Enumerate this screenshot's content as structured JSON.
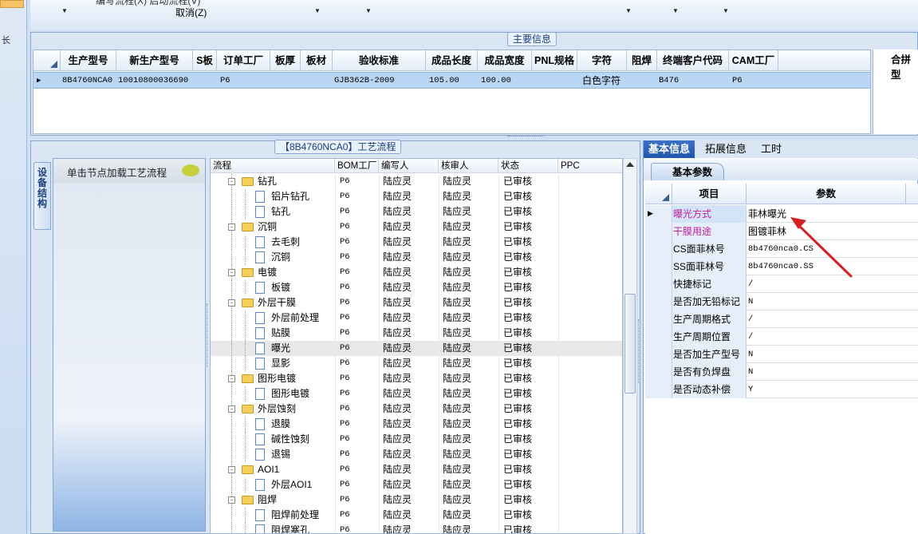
{
  "toolbar": {
    "cut_text": "编写流程(X)  启动流程(V)",
    "cancel_label": "取消(Z)",
    "left_mark": "长"
  },
  "main": {
    "legend": "主要信息",
    "columns": [
      "生产型号",
      "新生产型号",
      "S板",
      "订单工厂",
      "板厚",
      "板材",
      "验收标准",
      "成品长度",
      "成品宽度",
      "PNL规格",
      "字符",
      "阻焊",
      "终端客户代码",
      "CAM工厂"
    ],
    "row": [
      "8B4760NCA0",
      "10010800036690",
      "",
      "P6",
      "",
      "",
      "GJB362B-2009",
      "105.00",
      "100.00",
      "",
      "白色字符",
      "",
      "B476",
      "P6"
    ],
    "merge_title": "合拼型"
  },
  "process": {
    "legend": "【8B4760NCA0】工艺流程",
    "vtab": "设备结构",
    "node_hint": "单击节点加载工艺流程",
    "columns": [
      "流程",
      "BOM工厂",
      "编写人",
      "核审人",
      "状态",
      "PPC"
    ],
    "rows": [
      {
        "name": "钻孔",
        "type": "folder",
        "bom": "P6",
        "writer": "陆应灵",
        "reviewer": "陆应灵",
        "status": "已审核"
      },
      {
        "name": "铝片钻孔",
        "type": "file",
        "bom": "P6",
        "writer": "陆应灵",
        "reviewer": "陆应灵",
        "status": "已审核"
      },
      {
        "name": "钻孔",
        "type": "file",
        "bom": "P6",
        "writer": "陆应灵",
        "reviewer": "陆应灵",
        "status": "已审核"
      },
      {
        "name": "沉铜",
        "type": "folder",
        "bom": "P6",
        "writer": "陆应灵",
        "reviewer": "陆应灵",
        "status": "已审核"
      },
      {
        "name": "去毛刺",
        "type": "file",
        "bom": "P6",
        "writer": "陆应灵",
        "reviewer": "陆应灵",
        "status": "已审核"
      },
      {
        "name": "沉铜",
        "type": "file",
        "bom": "P6",
        "writer": "陆应灵",
        "reviewer": "陆应灵",
        "status": "已审核"
      },
      {
        "name": "电镀",
        "type": "folder",
        "bom": "P6",
        "writer": "陆应灵",
        "reviewer": "陆应灵",
        "status": "已审核"
      },
      {
        "name": "板镀",
        "type": "file",
        "bom": "P6",
        "writer": "陆应灵",
        "reviewer": "陆应灵",
        "status": "已审核"
      },
      {
        "name": "外层干膜",
        "type": "folder",
        "bom": "P6",
        "writer": "陆应灵",
        "reviewer": "陆应灵",
        "status": "已审核"
      },
      {
        "name": "外层前处理",
        "type": "file",
        "bom": "P6",
        "writer": "陆应灵",
        "reviewer": "陆应灵",
        "status": "已审核"
      },
      {
        "name": "贴膜",
        "type": "file",
        "bom": "P6",
        "writer": "陆应灵",
        "reviewer": "陆应灵",
        "status": "已审核"
      },
      {
        "name": "曝光",
        "type": "file",
        "bom": "P6",
        "writer": "陆应灵",
        "reviewer": "陆应灵",
        "status": "已审核",
        "selected": true
      },
      {
        "name": "显影",
        "type": "file",
        "bom": "P6",
        "writer": "陆应灵",
        "reviewer": "陆应灵",
        "status": "已审核"
      },
      {
        "name": "图形电镀",
        "type": "folder",
        "bom": "P6",
        "writer": "陆应灵",
        "reviewer": "陆应灵",
        "status": "已审核"
      },
      {
        "name": "图形电镀",
        "type": "file",
        "bom": "P6",
        "writer": "陆应灵",
        "reviewer": "陆应灵",
        "status": "已审核"
      },
      {
        "name": "外层蚀刻",
        "type": "folder",
        "bom": "P6",
        "writer": "陆应灵",
        "reviewer": "陆应灵",
        "status": "已审核"
      },
      {
        "name": "退膜",
        "type": "file",
        "bom": "P6",
        "writer": "陆应灵",
        "reviewer": "陆应灵",
        "status": "已审核"
      },
      {
        "name": "碱性蚀刻",
        "type": "file",
        "bom": "P6",
        "writer": "陆应灵",
        "reviewer": "陆应灵",
        "status": "已审核"
      },
      {
        "name": "退锡",
        "type": "file",
        "bom": "P6",
        "writer": "陆应灵",
        "reviewer": "陆应灵",
        "status": "已审核"
      },
      {
        "name": "AOI1",
        "type": "folder",
        "bom": "P6",
        "writer": "陆应灵",
        "reviewer": "陆应灵",
        "status": "已审核"
      },
      {
        "name": "外层AOI1",
        "type": "file",
        "bom": "P6",
        "writer": "陆应灵",
        "reviewer": "陆应灵",
        "status": "已审核"
      },
      {
        "name": "阻焊",
        "type": "folder",
        "bom": "P6",
        "writer": "陆应灵",
        "reviewer": "陆应灵",
        "status": "已审核"
      },
      {
        "name": "阻焊前处理",
        "type": "file",
        "bom": "P6",
        "writer": "陆应灵",
        "reviewer": "陆应灵",
        "status": "已审核"
      },
      {
        "name": "阻焊塞孔",
        "type": "file",
        "bom": "P6",
        "writer": "陆应灵",
        "reviewer": "陆应灵",
        "status": "已审核"
      }
    ]
  },
  "right": {
    "tabs": [
      "基本信息",
      "拓展信息",
      "工时"
    ],
    "subtab": "基本参数",
    "columns": [
      "项目",
      "参数"
    ],
    "params": [
      {
        "name": "曝光方式",
        "value": "菲林曝光",
        "highlight": true
      },
      {
        "name": "干膜用途",
        "value": "图镀菲林",
        "highlight": true
      },
      {
        "name": "CS面菲林号",
        "value": "8b4760nca0.CS"
      },
      {
        "name": "SS面菲林号",
        "value": "8b4760nca0.SS"
      },
      {
        "name": "快捷标记",
        "value": "/"
      },
      {
        "name": "是否加无铅标记",
        "value": "N"
      },
      {
        "name": "生产周期格式",
        "value": "/"
      },
      {
        "name": "生产周期位置",
        "value": "/"
      },
      {
        "name": "是否加生产型号",
        "value": "N"
      },
      {
        "name": "是否有负焊盘",
        "value": "N"
      },
      {
        "name": "是否动态补偿",
        "value": "Y"
      }
    ]
  },
  "colors": {
    "highlight_text": "#c0209a",
    "selection": "#b9d6f5",
    "arrow": "#d81e1e",
    "accent_tab": "#1e57b0"
  }
}
